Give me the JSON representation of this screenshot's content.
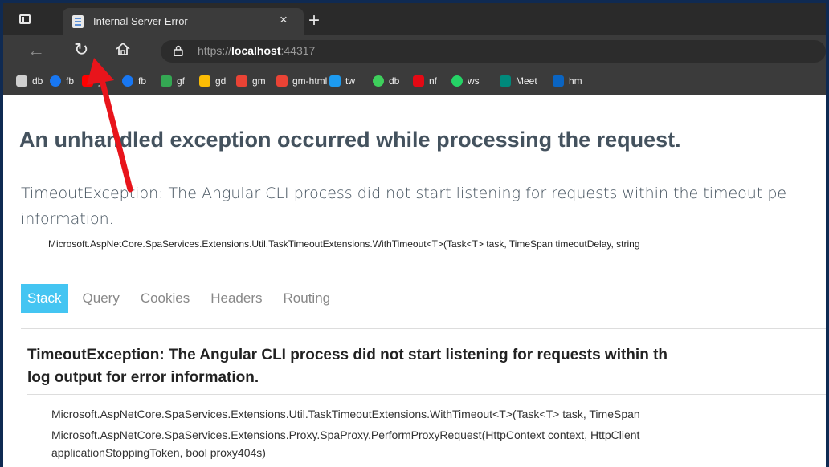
{
  "browser": {
    "tab_title": "Internal Server Error",
    "close_glyph": "×",
    "newtab_glyph": "+",
    "back_glyph": "←",
    "reload_glyph": "↻",
    "url_prefix": "https://",
    "url_host": "localhost",
    "url_port": ":44317"
  },
  "bookmarks": [
    {
      "label": "db",
      "icon": "document-icon",
      "color": "#cfcfcf"
    },
    {
      "label": "fb",
      "icon": "facebook-icon",
      "color": "#1877f2"
    },
    {
      "label": "yt",
      "icon": "youtube-icon",
      "color": "#ff0000"
    },
    {
      "label": "fb",
      "icon": "facebook-icon",
      "color": "#1877f2"
    },
    {
      "label": "gf",
      "icon": "pinwheel-icon",
      "color": "#34a853"
    },
    {
      "label": "gd",
      "icon": "drive-icon",
      "color": "#fbbc04"
    },
    {
      "label": "gm",
      "icon": "gmail-icon",
      "color": "#ea4335"
    },
    {
      "label": "gm-html",
      "icon": "gmail-icon",
      "color": "#ea4335"
    },
    {
      "label": "tw",
      "icon": "twitter-icon",
      "color": "#1d9bf0"
    },
    {
      "label": "db",
      "icon": "dropbox-icon",
      "color": "#3ecf5c"
    },
    {
      "label": "nf",
      "icon": "netflix-icon",
      "color": "#e50914"
    },
    {
      "label": "ws",
      "icon": "whatsapp-icon",
      "color": "#25d366"
    },
    {
      "label": "Meet",
      "icon": "meet-icon",
      "color": "#00897b"
    },
    {
      "label": "hm",
      "icon": "outlook-icon",
      "color": "#0a64c2"
    }
  ],
  "page": {
    "heading": "An unhandled exception occurred while processing the request.",
    "title_error_line1": "TimeoutException: The Angular CLI process did not start listening for requests within the timeout pe",
    "title_error_line2": "information.",
    "location": "Microsoft.AspNetCore.SpaServices.Extensions.Util.TaskTimeoutExtensions.WithTimeout<T>(Task<T> task, TimeSpan timeoutDelay, string",
    "tabs": [
      {
        "label": "Stack",
        "active": true
      },
      {
        "label": "Query",
        "active": false
      },
      {
        "label": "Cookies",
        "active": false
      },
      {
        "label": "Headers",
        "active": false
      },
      {
        "label": "Routing",
        "active": false
      }
    ],
    "stack_heading_line1": "TimeoutException: The Angular CLI process did not start listening for requests within th",
    "stack_heading_line2": "log output for error information.",
    "frames": [
      "Microsoft.AspNetCore.SpaServices.Extensions.Util.TaskTimeoutExtensions.WithTimeout<T>(Task<T> task, TimeSpan",
      "Microsoft.AspNetCore.SpaServices.Extensions.Proxy.SpaProxy.PerformProxyRequest(HttpContext context, HttpClient",
      "applicationStoppingToken, bool proxy404s)"
    ]
  },
  "colors": {
    "accent": "#44c5f2",
    "arrow": "#e8141b",
    "heading": "#44525e"
  }
}
